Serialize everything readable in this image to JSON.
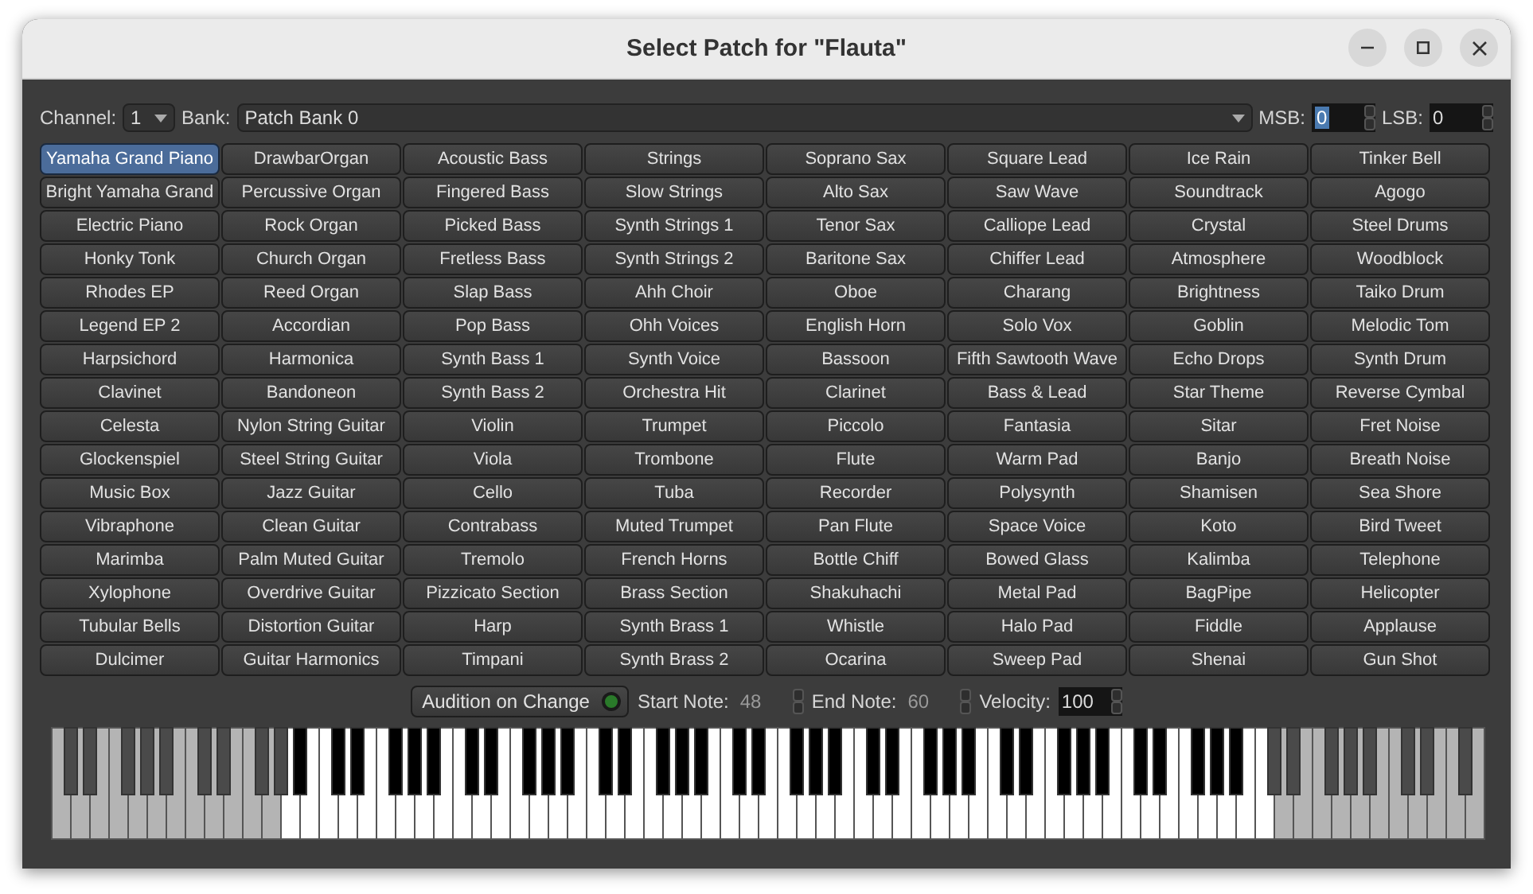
{
  "window": {
    "title": "Select Patch for \"Flauta\""
  },
  "toolbar": {
    "channel_label": "Channel:",
    "channel": "1",
    "bank_label": "Bank:",
    "bank": "Patch Bank 0",
    "msb_label": "MSB:",
    "msb": "0",
    "msb_selected": true,
    "lsb_label": "LSB:",
    "lsb": "0"
  },
  "patches": [
    {
      "label": "Yamaha Grand Piano",
      "selected": true
    },
    {
      "label": "DrawbarOrgan",
      "selected": false
    },
    {
      "label": "Acoustic Bass",
      "selected": false
    },
    {
      "label": "Strings",
      "selected": false
    },
    {
      "label": "Soprano Sax",
      "selected": false
    },
    {
      "label": "Square Lead",
      "selected": false
    },
    {
      "label": "Ice Rain",
      "selected": false
    },
    {
      "label": "Tinker Bell",
      "selected": false
    },
    {
      "label": "Bright Yamaha Grand",
      "selected": false
    },
    {
      "label": "Percussive Organ",
      "selected": false
    },
    {
      "label": "Fingered Bass",
      "selected": false
    },
    {
      "label": "Slow Strings",
      "selected": false
    },
    {
      "label": "Alto Sax",
      "selected": false
    },
    {
      "label": "Saw Wave",
      "selected": false
    },
    {
      "label": "Soundtrack",
      "selected": false
    },
    {
      "label": "Agogo",
      "selected": false
    },
    {
      "label": "Electric Piano",
      "selected": false
    },
    {
      "label": "Rock Organ",
      "selected": false
    },
    {
      "label": "Picked Bass",
      "selected": false
    },
    {
      "label": "Synth Strings 1",
      "selected": false
    },
    {
      "label": "Tenor Sax",
      "selected": false
    },
    {
      "label": "Calliope Lead",
      "selected": false
    },
    {
      "label": "Crystal",
      "selected": false
    },
    {
      "label": "Steel Drums",
      "selected": false
    },
    {
      "label": "Honky Tonk",
      "selected": false
    },
    {
      "label": "Church Organ",
      "selected": false
    },
    {
      "label": "Fretless Bass",
      "selected": false
    },
    {
      "label": "Synth Strings 2",
      "selected": false
    },
    {
      "label": "Baritone Sax",
      "selected": false
    },
    {
      "label": "Chiffer Lead",
      "selected": false
    },
    {
      "label": "Atmosphere",
      "selected": false
    },
    {
      "label": "Woodblock",
      "selected": false
    },
    {
      "label": "Rhodes EP",
      "selected": false
    },
    {
      "label": "Reed Organ",
      "selected": false
    },
    {
      "label": "Slap Bass",
      "selected": false
    },
    {
      "label": "Ahh Choir",
      "selected": false
    },
    {
      "label": "Oboe",
      "selected": false
    },
    {
      "label": "Charang",
      "selected": false
    },
    {
      "label": "Brightness",
      "selected": false
    },
    {
      "label": "Taiko Drum",
      "selected": false
    },
    {
      "label": "Legend EP 2",
      "selected": false
    },
    {
      "label": "Accordian",
      "selected": false
    },
    {
      "label": "Pop Bass",
      "selected": false
    },
    {
      "label": "Ohh Voices",
      "selected": false
    },
    {
      "label": "English Horn",
      "selected": false
    },
    {
      "label": "Solo Vox",
      "selected": false
    },
    {
      "label": "Goblin",
      "selected": false
    },
    {
      "label": "Melodic Tom",
      "selected": false
    },
    {
      "label": "Harpsichord",
      "selected": false
    },
    {
      "label": "Harmonica",
      "selected": false
    },
    {
      "label": "Synth Bass 1",
      "selected": false
    },
    {
      "label": "Synth Voice",
      "selected": false
    },
    {
      "label": "Bassoon",
      "selected": false
    },
    {
      "label": "Fifth Sawtooth Wave",
      "selected": false
    },
    {
      "label": "Echo Drops",
      "selected": false
    },
    {
      "label": "Synth Drum",
      "selected": false
    },
    {
      "label": "Clavinet",
      "selected": false
    },
    {
      "label": "Bandoneon",
      "selected": false
    },
    {
      "label": "Synth Bass 2",
      "selected": false
    },
    {
      "label": "Orchestra Hit",
      "selected": false
    },
    {
      "label": "Clarinet",
      "selected": false
    },
    {
      "label": "Bass & Lead",
      "selected": false
    },
    {
      "label": "Star Theme",
      "selected": false
    },
    {
      "label": "Reverse Cymbal",
      "selected": false
    },
    {
      "label": "Celesta",
      "selected": false
    },
    {
      "label": "Nylon String Guitar",
      "selected": false
    },
    {
      "label": "Violin",
      "selected": false
    },
    {
      "label": "Trumpet",
      "selected": false
    },
    {
      "label": "Piccolo",
      "selected": false
    },
    {
      "label": "Fantasia",
      "selected": false
    },
    {
      "label": "Sitar",
      "selected": false
    },
    {
      "label": "Fret Noise",
      "selected": false
    },
    {
      "label": "Glockenspiel",
      "selected": false
    },
    {
      "label": "Steel String Guitar",
      "selected": false
    },
    {
      "label": "Viola",
      "selected": false
    },
    {
      "label": "Trombone",
      "selected": false
    },
    {
      "label": "Flute",
      "selected": false
    },
    {
      "label": "Warm Pad",
      "selected": false
    },
    {
      "label": "Banjo",
      "selected": false
    },
    {
      "label": "Breath Noise",
      "selected": false
    },
    {
      "label": "Music Box",
      "selected": false
    },
    {
      "label": "Jazz Guitar",
      "selected": false
    },
    {
      "label": "Cello",
      "selected": false
    },
    {
      "label": "Tuba",
      "selected": false
    },
    {
      "label": "Recorder",
      "selected": false
    },
    {
      "label": "Polysynth",
      "selected": false
    },
    {
      "label": "Shamisen",
      "selected": false
    },
    {
      "label": "Sea Shore",
      "selected": false
    },
    {
      "label": "Vibraphone",
      "selected": false
    },
    {
      "label": "Clean Guitar",
      "selected": false
    },
    {
      "label": "Contrabass",
      "selected": false
    },
    {
      "label": "Muted Trumpet",
      "selected": false
    },
    {
      "label": "Pan Flute",
      "selected": false
    },
    {
      "label": "Space Voice",
      "selected": false
    },
    {
      "label": "Koto",
      "selected": false
    },
    {
      "label": "Bird Tweet",
      "selected": false
    },
    {
      "label": "Marimba",
      "selected": false
    },
    {
      "label": "Palm Muted Guitar",
      "selected": false
    },
    {
      "label": "Tremolo",
      "selected": false
    },
    {
      "label": "French Horns",
      "selected": false
    },
    {
      "label": "Bottle Chiff",
      "selected": false
    },
    {
      "label": "Bowed Glass",
      "selected": false
    },
    {
      "label": "Kalimba",
      "selected": false
    },
    {
      "label": "Telephone",
      "selected": false
    },
    {
      "label": "Xylophone",
      "selected": false
    },
    {
      "label": "Overdrive Guitar",
      "selected": false
    },
    {
      "label": "Pizzicato Section",
      "selected": false
    },
    {
      "label": "Brass Section",
      "selected": false
    },
    {
      "label": "Shakuhachi",
      "selected": false
    },
    {
      "label": "Metal Pad",
      "selected": false
    },
    {
      "label": "BagPipe",
      "selected": false
    },
    {
      "label": "Helicopter",
      "selected": false
    },
    {
      "label": "Tubular Bells",
      "selected": false
    },
    {
      "label": "Distortion Guitar",
      "selected": false
    },
    {
      "label": "Harp",
      "selected": false
    },
    {
      "label": "Synth Brass 1",
      "selected": false
    },
    {
      "label": "Whistle",
      "selected": false
    },
    {
      "label": "Halo Pad",
      "selected": false
    },
    {
      "label": "Fiddle",
      "selected": false
    },
    {
      "label": "Applause",
      "selected": false
    },
    {
      "label": "Dulcimer",
      "selected": false
    },
    {
      "label": "Guitar Harmonics",
      "selected": false
    },
    {
      "label": "Timpani",
      "selected": false
    },
    {
      "label": "Synth Brass 2",
      "selected": false
    },
    {
      "label": "Ocarina",
      "selected": false
    },
    {
      "label": "Sweep Pad",
      "selected": false
    },
    {
      "label": "Shenai",
      "selected": false
    },
    {
      "label": "Gun Shot",
      "selected": false
    }
  ],
  "audition": {
    "label": "Audition on Change",
    "on": true,
    "start_label": "Start Note:",
    "start": "48",
    "end_label": "End Note:",
    "end": "60",
    "velocity_label": "Velocity:",
    "velocity": "100"
  }
}
